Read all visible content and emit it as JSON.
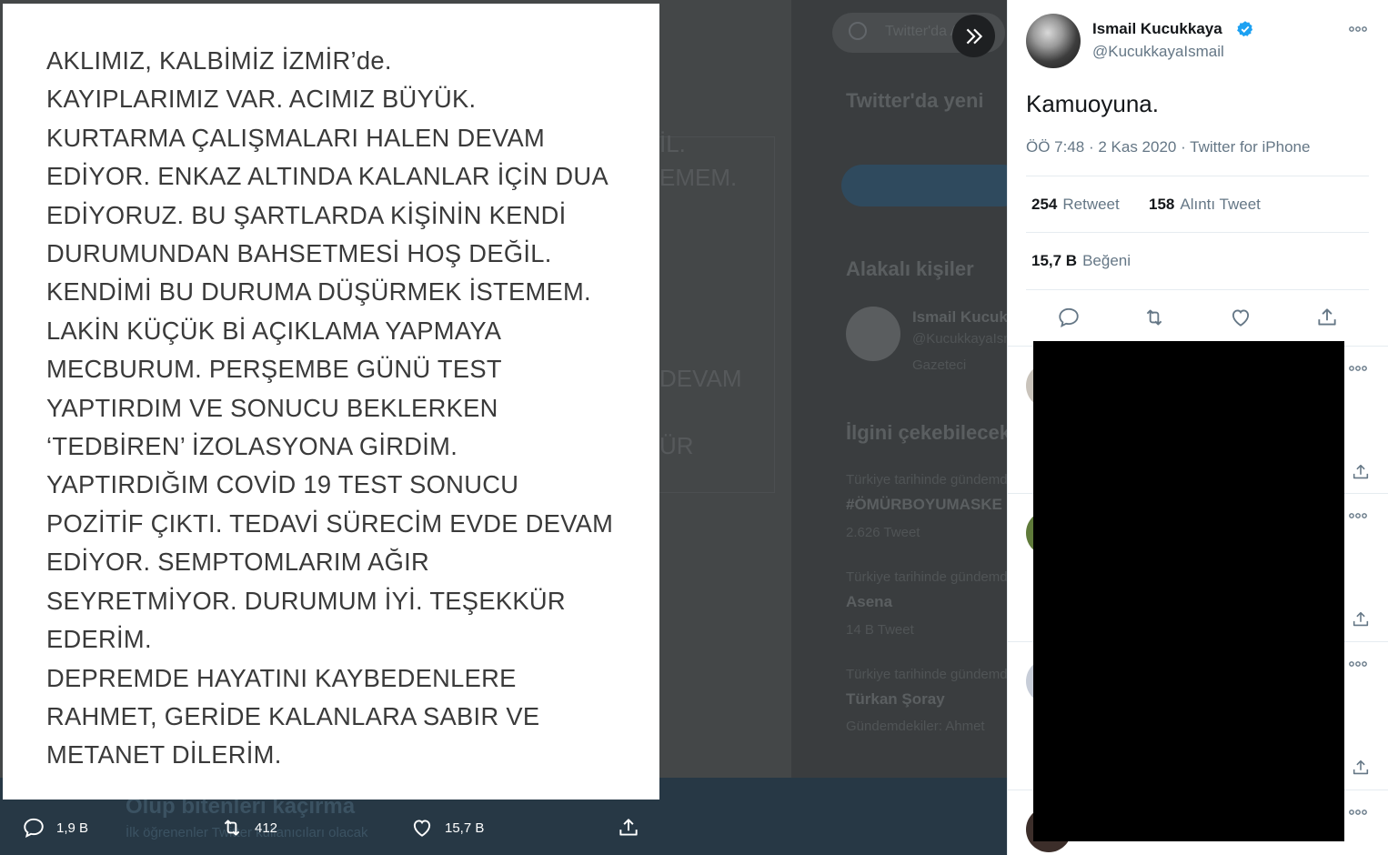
{
  "image_text_lines": [
    "AKLIMIZ, KALBİMİZ İZMİR’de.",
    "KAYIPLARIMIZ VAR. ACIMIZ BÜYÜK.",
    "KURTARMA ÇALIŞMALARI HALEN DEVAM",
    "EDİYOR. ENKAZ ALTINDA KALANLAR İÇİN DUA",
    "EDİYORUZ. BU ŞARTLARDA KİŞİNİN KENDİ",
    "DURUMUNDAN BAHSETMESİ HOŞ DEĞİL.",
    "KENDİMİ BU DURUMA DÜŞÜRMEK İSTEMEM.",
    "LAKİN KÜÇÜK Bİ AÇIKLAMA YAPMAYA",
    "MECBURUM. PERŞEMBE GÜNÜ TEST",
    "YAPTIRDIM VE SONUCU BEKLERKEN",
    "‘TEDBİREN’ İZOLASYONA GİRDİM.",
    "YAPTIRDIĞIM COVİD 19 TEST SONUCU",
    "POZİTİF ÇIKTI. TEDAVİ SÜRECİM EVDE DEVAM",
    "EDİYOR. SEMPTOMLARIM AĞIR",
    "SEYRETMİYOR. DURUMUM İYİ. TEŞEKKÜR",
    "EDERİM.",
    "DEPREMDE HAYATINI KAYBEDENLERE",
    "RAHMET, GERİDE KALANLARA SABIR VE",
    "METANET DİLERİM."
  ],
  "lightbox_bar": {
    "reply_count": "1,9 B",
    "retweet_count": "412",
    "like_count": "15,7 B"
  },
  "background_page": {
    "search_placeholder": "Twitter'da Ara",
    "new_on_twitter": "Twitter'da yeni",
    "related_people": "Alakalı kişiler",
    "related_name": "Ismail Kucukkaya",
    "related_handle": "@KucukkayaIsmail",
    "related_bio": "Gazeteci",
    "trends_title": "İlgini çekebilecek",
    "trend_1_context": "Türkiye tarihinde gündemde",
    "trend_1_name": "#ÖMÜRBOYUMASKE",
    "trend_1_count": "2.626 Tweet",
    "trend_2_context": "Türkiye tarihinde gündemde",
    "trend_2_name": "Asena",
    "trend_2_count": "14 B Tweet",
    "trend_3_context": "Türkiye tarihinde gündemde",
    "trend_3_name": "Türkan Şoray",
    "trend_3_count": "Gündemdekiler: Ahmet",
    "banner_title": "Olup bitenleri kaçırma",
    "banner_sub": "İlk öğrenenler Twitter kullanıcıları olacak"
  },
  "tweet": {
    "author_name": "Ismail Kucukkaya",
    "author_handle": "@KucukkayaIsmail",
    "text": "Kamuoyuna.",
    "meta": "ÖÖ 7:48 · 2 Kas 2020 · Twitter for iPhone",
    "retweets_num": "254",
    "retweets_label": "Retweet",
    "quotes_num": "158",
    "quotes_label": "Alıntı Tweet",
    "likes_num": "15,7 B",
    "likes_label": "Beğeni"
  },
  "colors": {
    "verified": "#1da1f2",
    "text_primary": "#14171a",
    "text_secondary": "#657786",
    "action_icon": "#657786"
  }
}
